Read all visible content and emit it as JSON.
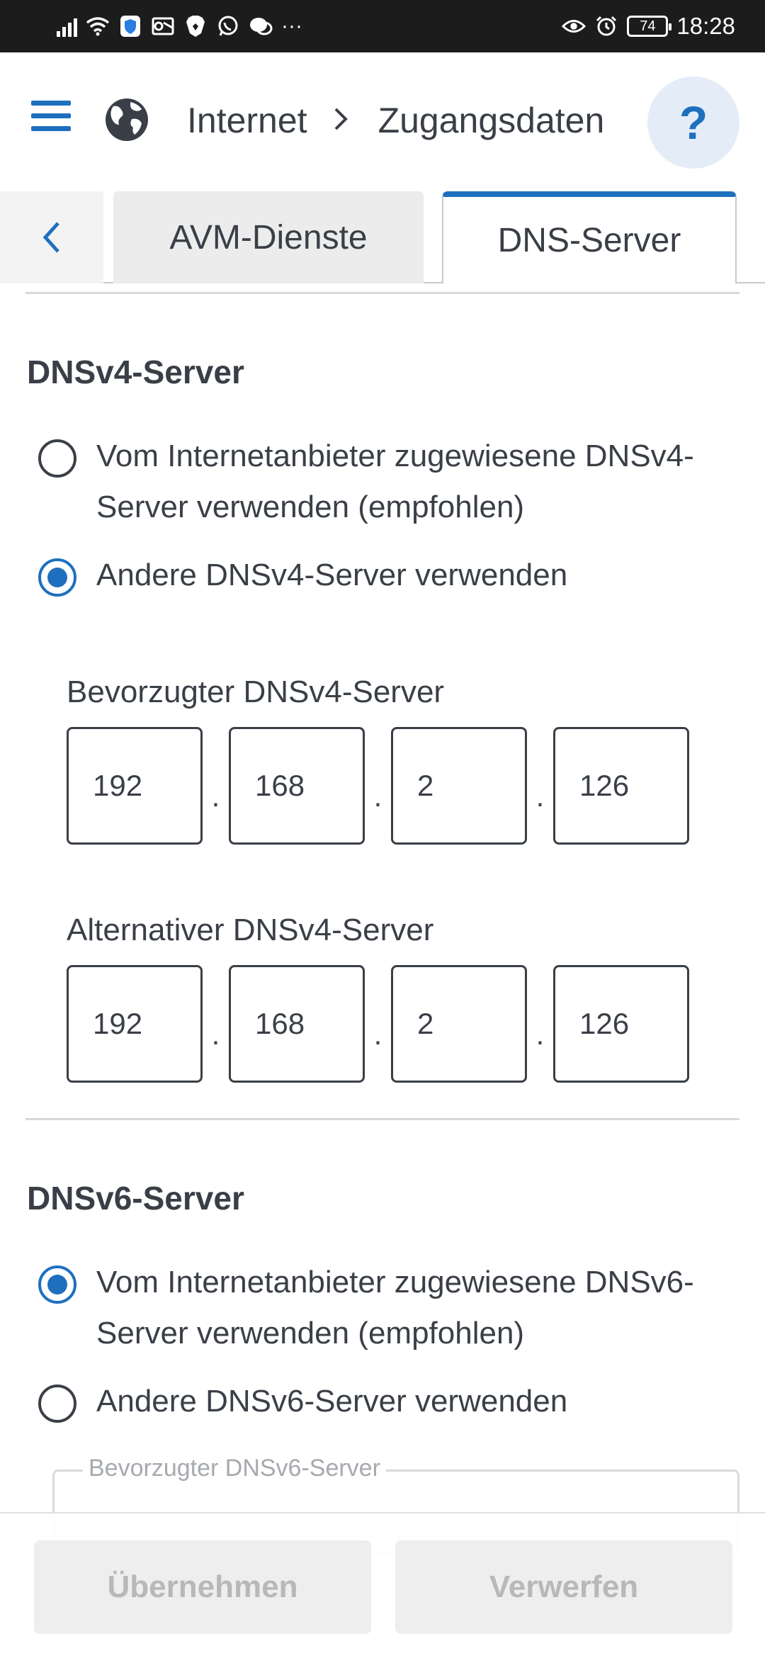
{
  "status_bar": {
    "time": "18:28",
    "battery": "74",
    "more": "···"
  },
  "header": {
    "breadcrumb": [
      "Internet",
      "Zugangsdaten"
    ],
    "help": "?"
  },
  "tabs": {
    "items": [
      "AVM-Dienste",
      "DNS-Server"
    ],
    "active": "DNS-Server"
  },
  "dnsv4": {
    "title": "DNSv4-Server",
    "options": [
      {
        "label": "Vom Internetanbieter zugewiesene DNSv4-Server verwenden (empfohlen)",
        "selected": false
      },
      {
        "label": "Andere DNSv4-Server verwenden",
        "selected": true
      }
    ],
    "preferred": {
      "label": "Bevorzugter DNSv4-Server",
      "octets": [
        "192",
        "168",
        "2",
        "126"
      ]
    },
    "alternative": {
      "label": "Alternativer DNSv4-Server",
      "octets": [
        "192",
        "168",
        "2",
        "126"
      ]
    }
  },
  "dnsv6": {
    "title": "DNSv6-Server",
    "options": [
      {
        "label": "Vom Internetanbieter zugewiesene DNSv6-Server verwenden (empfohlen)",
        "selected": true
      },
      {
        "label": "Andere DNSv6-Server verwenden",
        "selected": false
      }
    ],
    "preferred": {
      "label": "Bevorzugter DNSv6-Server"
    }
  },
  "actions": {
    "apply": "Übernehmen",
    "discard": "Verwerfen"
  },
  "colors": {
    "accent": "#1f6fbf",
    "text": "#3a3f47",
    "disabled_text": "#b8b8b8"
  }
}
